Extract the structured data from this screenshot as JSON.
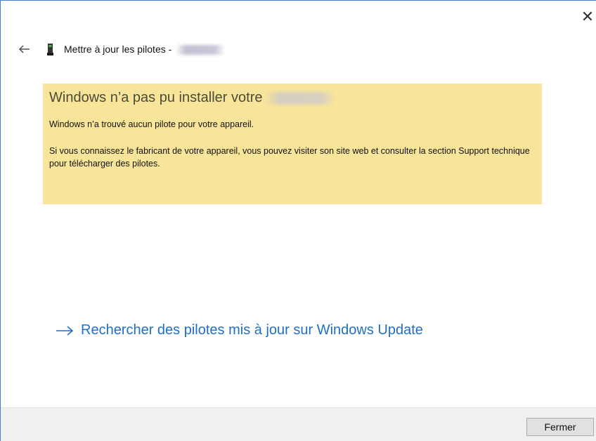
{
  "window": {
    "close_glyph": "✕"
  },
  "header": {
    "title": "Mettre à jour les pilotes -"
  },
  "banner": {
    "title": "Windows n’a pas pu installer votre",
    "message_1": "Windows n’a trouvé aucun pilote pour votre appareil.",
    "message_2": "Si vous connaissez le fabricant de votre appareil, vous pouvez visiter son site web et consulter la section Support technique pour télécharger des pilotes.",
    "background_color": "#f9e59a"
  },
  "link": {
    "label": "Rechercher des pilotes mis à jour sur Windows Update",
    "color": "#1f6fc5"
  },
  "footer": {
    "close_button_label": "Fermer"
  },
  "icons": {
    "back": "back-arrow-icon",
    "device": "device-icon",
    "link_arrow": "right-arrow-icon",
    "close": "close-icon"
  }
}
